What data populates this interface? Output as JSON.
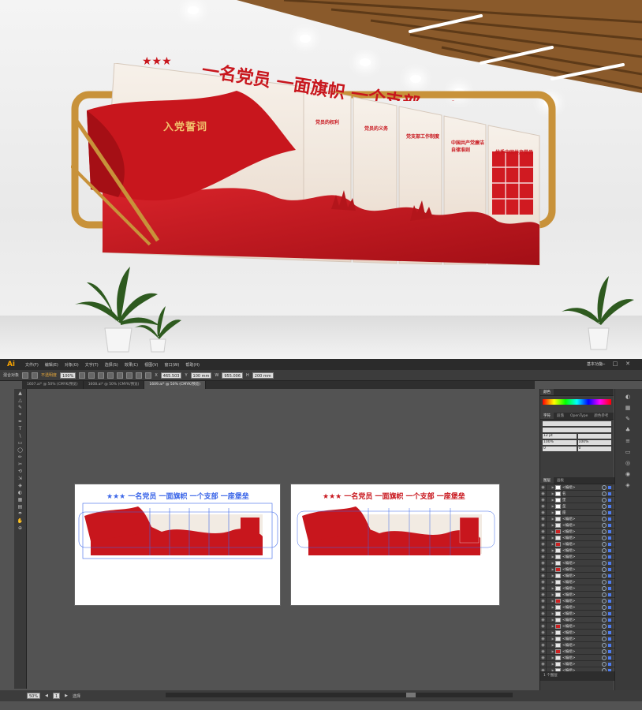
{
  "render": {
    "slogan": "一名党员 一面旗帜 一个支部 一座堡垒",
    "oath_title": "入党誓词",
    "panel_titles": [
      "党员的权利",
      "党员的义务",
      "党支部工作制度",
      "中国共产党廉洁自律准则",
      "优秀中国共产党员"
    ]
  },
  "app": {
    "logo": "Ai",
    "menu": [
      "文件(F)",
      "编辑(E)",
      "对象(O)",
      "文字(T)",
      "选择(S)",
      "效果(C)",
      "视图(V)",
      "窗口(W)",
      "帮助(H)"
    ],
    "workspace": "基本功能",
    "window_buttons": [
      "—",
      "□",
      "✕"
    ]
  },
  "control_bar": {
    "selection": "混合对象",
    "opacity_label": "不透明度",
    "opacity": "100%",
    "x": "465.503",
    "y": "100 mm",
    "w": "955.006",
    "h": "200 mm"
  },
  "tabs": [
    {
      "label": "1607.ai* @ 50% (CMYK/预览)",
      "active": false
    },
    {
      "label": "1608.ai* @ 50% (CMYK/预览)",
      "active": false
    },
    {
      "label": "1609.ai* @ 50% (CMYK/预览)",
      "active": true
    }
  ],
  "tools": [
    "▲",
    "△",
    "✎",
    "⌖",
    "✒",
    "T",
    "\\",
    "▭",
    "◯",
    "✏",
    "✂",
    "⟲",
    "⇲",
    "◈",
    "◐",
    "▦",
    "▤",
    "☂",
    "✋",
    "⊕"
  ],
  "status": {
    "zoom": "50%",
    "page": "1",
    "mode": "选择"
  },
  "panels": {
    "color_tab": "颜色",
    "char_tabs": [
      "字符",
      "段落",
      "OpenType",
      "颜色参考"
    ],
    "char_fields": [
      "",
      "",
      "12 pt",
      "",
      "100%",
      "100%",
      "0",
      "0"
    ],
    "layer_tabs": [
      "图层",
      "画板"
    ],
    "layers": [
      {
        "name": "<编组>",
        "thumb": "#ffffff"
      },
      {
        "name": "名",
        "thumb": "#ffffff"
      },
      {
        "name": "堡",
        "thumb": "#ffffff"
      },
      {
        "name": "垒",
        "thumb": "#ffffff"
      },
      {
        "name": "座",
        "thumb": "#ffffff"
      },
      {
        "name": "<编组>",
        "thumb": "#e8e8e8"
      },
      {
        "name": "<编组>",
        "thumb": "#e8e8e8"
      },
      {
        "name": "<编组>",
        "thumb": "#cc2222"
      },
      {
        "name": "<编组>",
        "thumb": "#e8e8e8"
      },
      {
        "name": "<编组>",
        "thumb": "#cc2222"
      },
      {
        "name": "<编组>",
        "thumb": "#e8e8e8"
      },
      {
        "name": "<编组>",
        "thumb": "#e8e8e8"
      },
      {
        "name": "<编组>",
        "thumb": "#e8e8e8"
      },
      {
        "name": "<编组>",
        "thumb": "#cc2222"
      },
      {
        "name": "<编组>",
        "thumb": "#e8e8e8"
      },
      {
        "name": "<编组>",
        "thumb": "#e8e8e8"
      },
      {
        "name": "<编组>",
        "thumb": "#e8e8e8"
      },
      {
        "name": "<编组>",
        "thumb": "#e8e8e8"
      },
      {
        "name": "<编组>",
        "thumb": "#cc2222"
      },
      {
        "name": "<编组>",
        "thumb": "#e8e8e8"
      },
      {
        "name": "<编组>",
        "thumb": "#e8e8e8"
      },
      {
        "name": "<编组>",
        "thumb": "#e8e8e8"
      },
      {
        "name": "<编组>",
        "thumb": "#cc2222"
      },
      {
        "name": "<编组>",
        "thumb": "#e8e8e8"
      },
      {
        "name": "<编组>",
        "thumb": "#e8e8e8"
      },
      {
        "name": "<编组>",
        "thumb": "#e8e8e8"
      },
      {
        "name": "<编组>",
        "thumb": "#cc2222"
      },
      {
        "name": "<编组>",
        "thumb": "#e8e8e8"
      },
      {
        "name": "<编组>",
        "thumb": "#e8e8e8"
      },
      {
        "name": "<编组>",
        "thumb": "#e8e8e8"
      },
      {
        "name": "<编组>",
        "thumb": "#e8e8e8"
      }
    ],
    "layers_footer": "1 个图层"
  },
  "colors": {
    "accent_red": "#c8161d",
    "gold": "#c8923a",
    "ui_dark": "#2b2b2b",
    "ui_mid": "#535353"
  }
}
